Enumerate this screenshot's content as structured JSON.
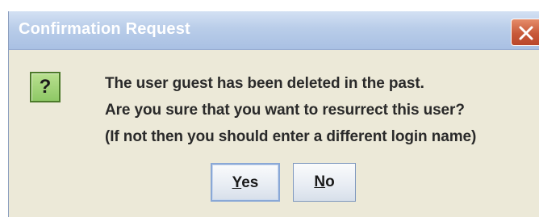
{
  "dialog": {
    "title": "Confirmation Request",
    "icon": "question-icon",
    "icon_glyph": "?",
    "message_lines": [
      "The user guest has been deleted in the past.",
      "Are you sure that you want to resurrect this user?",
      "(If not then you should enter a different login name)"
    ],
    "buttons": {
      "yes": {
        "mnemonic": "Y",
        "rest": "es"
      },
      "no": {
        "mnemonic": "N",
        "rest": "o"
      }
    },
    "close_icon": "close-icon"
  },
  "colors": {
    "titlebar": "#b9cde9",
    "close_button": "#c85a3a",
    "icon_background": "#8ec866",
    "dialog_background": "#ece9d8"
  }
}
